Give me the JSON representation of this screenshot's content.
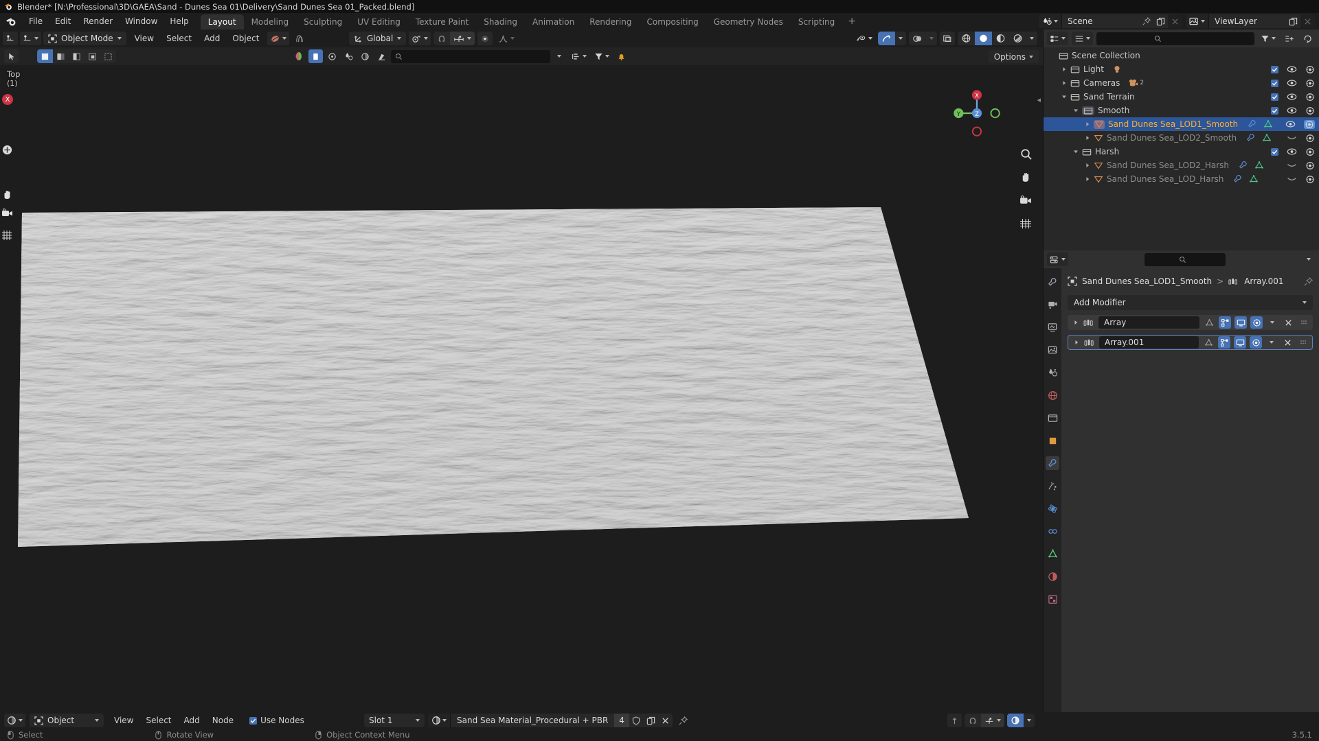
{
  "window": {
    "title": "Blender* [N:\\Professional\\3D\\GAEA\\Sand - Dunes Sea 01\\Delivery\\Sand Dunes Sea 01_Packed.blend]"
  },
  "topbar": {
    "menus": [
      "File",
      "Edit",
      "Render",
      "Window",
      "Help"
    ],
    "workspaces": [
      {
        "label": "Layout",
        "active": true
      },
      {
        "label": "Modeling",
        "active": false
      },
      {
        "label": "Sculpting",
        "active": false
      },
      {
        "label": "UV Editing",
        "active": false
      },
      {
        "label": "Texture Paint",
        "active": false
      },
      {
        "label": "Shading",
        "active": false
      },
      {
        "label": "Animation",
        "active": false
      },
      {
        "label": "Rendering",
        "active": false
      },
      {
        "label": "Compositing",
        "active": false
      },
      {
        "label": "Geometry Nodes",
        "active": false
      },
      {
        "label": "Scripting",
        "active": false
      }
    ],
    "add_workspace": "+",
    "scene_name": "Scene",
    "viewlayer_name": "ViewLayer"
  },
  "viewport": {
    "mode": "Object Mode",
    "menus": [
      "View",
      "Select",
      "Add",
      "Object"
    ],
    "transform_orientation": "Global",
    "options_label": "Options",
    "view_name": "Top",
    "view_collection": "(1)",
    "axis_x_label": "X",
    "axis_y_label": "Y",
    "axis_z_label": "Z",
    "gizmo_x": "X",
    "gizmo_y": "Y",
    "gizmo_z": "Z"
  },
  "outliner": {
    "rows": [
      {
        "label": "Scene Collection",
        "indent": 0,
        "type": "collection",
        "disclosure": "",
        "selected": false,
        "checkbox": null,
        "eye": null,
        "camera": null
      },
      {
        "label": "Light",
        "indent": 1,
        "type": "collection",
        "disclosure": "right",
        "selected": false,
        "checkbox": true,
        "eye": "open",
        "camera": "on",
        "badge": "light"
      },
      {
        "label": "Cameras",
        "indent": 1,
        "type": "collection",
        "disclosure": "right",
        "selected": false,
        "checkbox": true,
        "eye": "open",
        "camera": "on",
        "badge": "camera",
        "badge_count": "2"
      },
      {
        "label": "Sand Terrain",
        "indent": 1,
        "type": "collection",
        "disclosure": "down",
        "selected": false,
        "checkbox": true,
        "eye": "open",
        "camera": "on"
      },
      {
        "label": "Smooth",
        "indent": 2,
        "type": "collection",
        "disclosure": "down",
        "selected": false,
        "checkbox": true,
        "eye": "open",
        "camera": "on"
      },
      {
        "label": "Sand Dunes Sea_LOD1_Smooth",
        "indent": 3,
        "type": "mesh",
        "disclosure": "right",
        "selected": true,
        "checkbox": null,
        "eye": "open",
        "camera": "on"
      },
      {
        "label": "Sand Dunes Sea_LOD2_Smooth",
        "indent": 3,
        "type": "mesh",
        "disclosure": "right",
        "selected": false,
        "checkbox": null,
        "eye": "closed",
        "camera": "on"
      },
      {
        "label": "Harsh",
        "indent": 2,
        "type": "collection",
        "disclosure": "down",
        "selected": false,
        "checkbox": true,
        "eye": "open",
        "camera": "on"
      },
      {
        "label": "Sand Dunes Sea_LOD2_Harsh",
        "indent": 3,
        "type": "mesh",
        "disclosure": "right",
        "selected": false,
        "checkbox": null,
        "eye": "closed",
        "camera": "on"
      },
      {
        "label": "Sand Dunes Sea_LOD_Harsh",
        "indent": 3,
        "type": "mesh",
        "disclosure": "right",
        "selected": false,
        "checkbox": null,
        "eye": "closed",
        "camera": "on"
      }
    ]
  },
  "properties": {
    "breadcrumb_object": "Sand Dunes Sea_LOD1_Smooth",
    "breadcrumb_sep": ">",
    "breadcrumb_modifier": "Array.001",
    "add_modifier_label": "Add Modifier",
    "modifiers": [
      {
        "name": "Array",
        "active": false,
        "edit_mode": true,
        "realtime": true,
        "render": true,
        "cage": false
      },
      {
        "name": "Array.001",
        "active": true,
        "edit_mode": true,
        "realtime": true,
        "render": true,
        "cage": false
      }
    ]
  },
  "node_editor": {
    "shader_type": "Object",
    "menus": [
      "View",
      "Select",
      "Add",
      "Node"
    ],
    "use_nodes_label": "Use Nodes",
    "use_nodes_checked": true,
    "slot_label": "Slot 1",
    "material_name": "Sand Sea Material_Procedural + PBR",
    "material_users": "4"
  },
  "statusbar": {
    "select": "Select",
    "rotate_view": "Rotate View",
    "context_menu": "Object Context Menu",
    "version": "3.5.1"
  },
  "colors": {
    "accent_blue": "#4772b3",
    "selected_row": "#2c5699",
    "selected_text": "#ffaf29",
    "mesh_orange": "#c87d4b",
    "collection_gray": "#b0b0b0",
    "header_bg": "#303030",
    "panel_bg": "#282828",
    "window_bg": "#1d1d1d"
  }
}
